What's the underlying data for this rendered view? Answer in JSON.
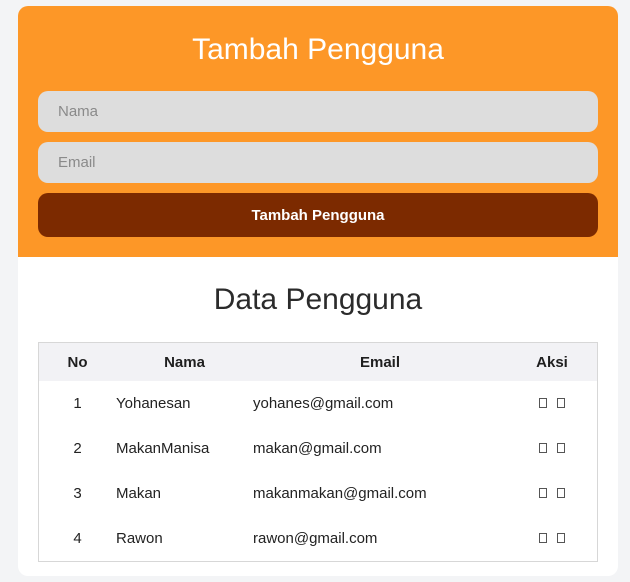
{
  "form": {
    "title": "Tambah Pengguna",
    "name_placeholder": "Nama",
    "email_placeholder": "Email",
    "submit_label": "Tambah Pengguna"
  },
  "table": {
    "title": "Data Pengguna",
    "headers": {
      "no": "No",
      "name": "Nama",
      "email": "Email",
      "actions": "Aksi"
    },
    "rows": [
      {
        "no": "1",
        "name": "Yohanesan",
        "email": "yohanes@gmail.com"
      },
      {
        "no": "2",
        "name": "MakanManisa",
        "email": "makan@gmail.com"
      },
      {
        "no": "3",
        "name": "Makan",
        "email": "makanmakan@gmail.com"
      },
      {
        "no": "4",
        "name": "Rawon",
        "email": "rawon@gmail.com"
      }
    ],
    "action_icons": [
      "edit-icon",
      "delete-icon"
    ]
  },
  "colors": {
    "accent": "#fd9727",
    "button": "#7c2a00",
    "input_bg": "#dddddd",
    "header_bg": "#f2f2f5"
  }
}
